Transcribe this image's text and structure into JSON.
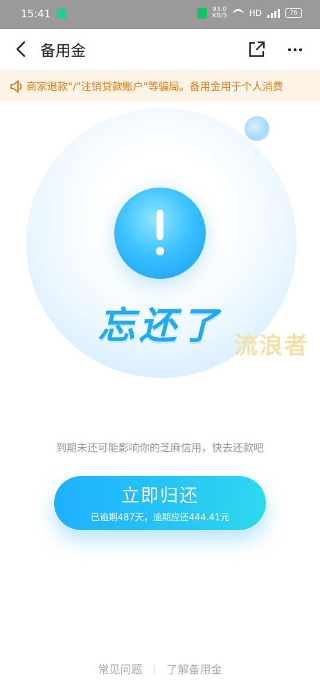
{
  "status_bar": {
    "time": "15:41",
    "net_speed_value": "93.0",
    "net_speed_unit": "KB/S",
    "hd": "HD",
    "network": "4G",
    "battery": "76"
  },
  "header": {
    "title": "备用金"
  },
  "notice": {
    "text": "商家退款\"/\"注销贷款账户\"等骗局。备用金用于个人消费"
  },
  "illustration": {
    "headline": "忘还了",
    "watermark": "流浪者"
  },
  "main": {
    "subtitle": "到期未还可能影响你的芝麻信用，快去还款吧",
    "repay_button": {
      "label": "立即归还",
      "detail": "已逾期487天，逾期应还444.41元"
    }
  },
  "footer": {
    "link_faq": "常见问题",
    "divider": "|",
    "link_learn": "了解备用金"
  },
  "colors": {
    "accent": "#23a8f2",
    "notice_text": "#e67a15",
    "notice_bg": "#fdf4e6"
  }
}
